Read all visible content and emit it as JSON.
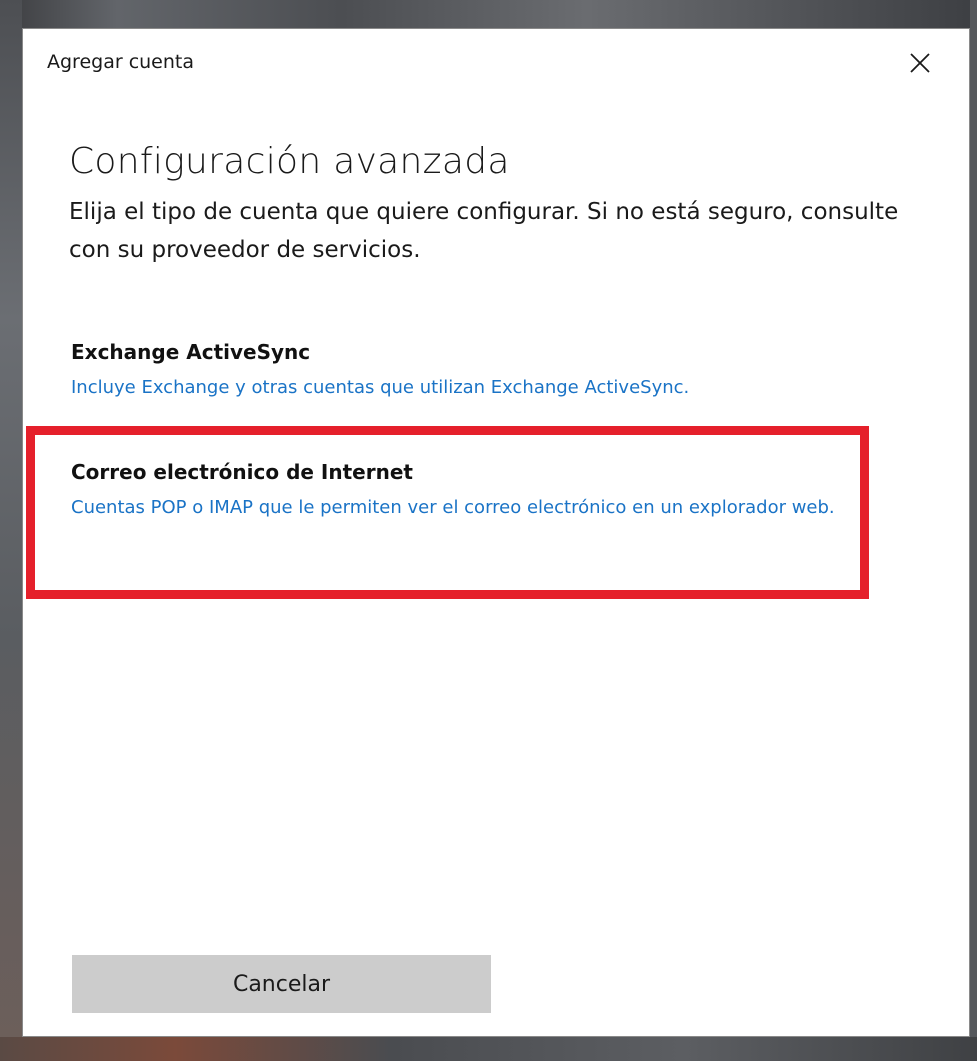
{
  "window": {
    "title": "Agregar cuenta",
    "close_icon": "close-icon"
  },
  "header": {
    "title": "Configuración avanzada",
    "subtitle": "Elija el tipo de cuenta que quiere configurar. Si no está seguro, consulte con su proveedor de servicios."
  },
  "options": [
    {
      "title": "Exchange ActiveSync",
      "description": "Incluye Exchange y otras cuentas que utilizan Exchange ActiveSync."
    },
    {
      "title": "Correo electrónico de Internet",
      "description": "Cuentas POP o IMAP que le permiten ver el correo electrónico en un explorador web."
    }
  ],
  "footer": {
    "cancel_label": "Cancelar"
  },
  "colors": {
    "link": "#1a73c6",
    "highlight": "#e5202b",
    "button_bg": "#cccccc"
  }
}
